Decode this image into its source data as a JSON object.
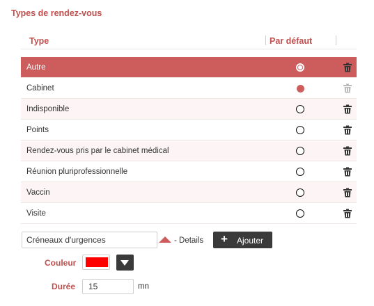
{
  "section_title": "Types de rendez-vous",
  "table": {
    "columns": {
      "type": "Type",
      "default": "Par défaut"
    },
    "rows": [
      {
        "label": "Autre",
        "selected": true,
        "is_default": false,
        "deletable": true
      },
      {
        "label": "Cabinet",
        "selected": false,
        "is_default": true,
        "deletable": false
      },
      {
        "label": "Indisponible",
        "selected": false,
        "is_default": false,
        "deletable": true
      },
      {
        "label": "Points",
        "selected": false,
        "is_default": false,
        "deletable": true
      },
      {
        "label": "Rendez-vous pris par le cabinet médical",
        "selected": false,
        "is_default": false,
        "deletable": true
      },
      {
        "label": "Réunion pluriprofessionnelle",
        "selected": false,
        "is_default": false,
        "deletable": true
      },
      {
        "label": "Vaccin",
        "selected": false,
        "is_default": false,
        "deletable": true
      },
      {
        "label": "Visite",
        "selected": false,
        "is_default": false,
        "deletable": true
      }
    ]
  },
  "form": {
    "name_value": "Créneaux d'urgences",
    "details_label": "- Details",
    "add_label": "Ajouter",
    "color_label": "Couleur",
    "color_value": "#ff0000",
    "duration_label": "Durée",
    "duration_value": "15",
    "duration_unit": "mn"
  },
  "colors": {
    "accent": "#c0504d",
    "selected_row": "#cd5c5c",
    "dark_button": "#3a3a3a"
  },
  "icons": {
    "delete": "trash-icon",
    "add": "plus-icon",
    "details_toggle": "triangle-up-icon",
    "dropdown": "caret-down-icon"
  }
}
